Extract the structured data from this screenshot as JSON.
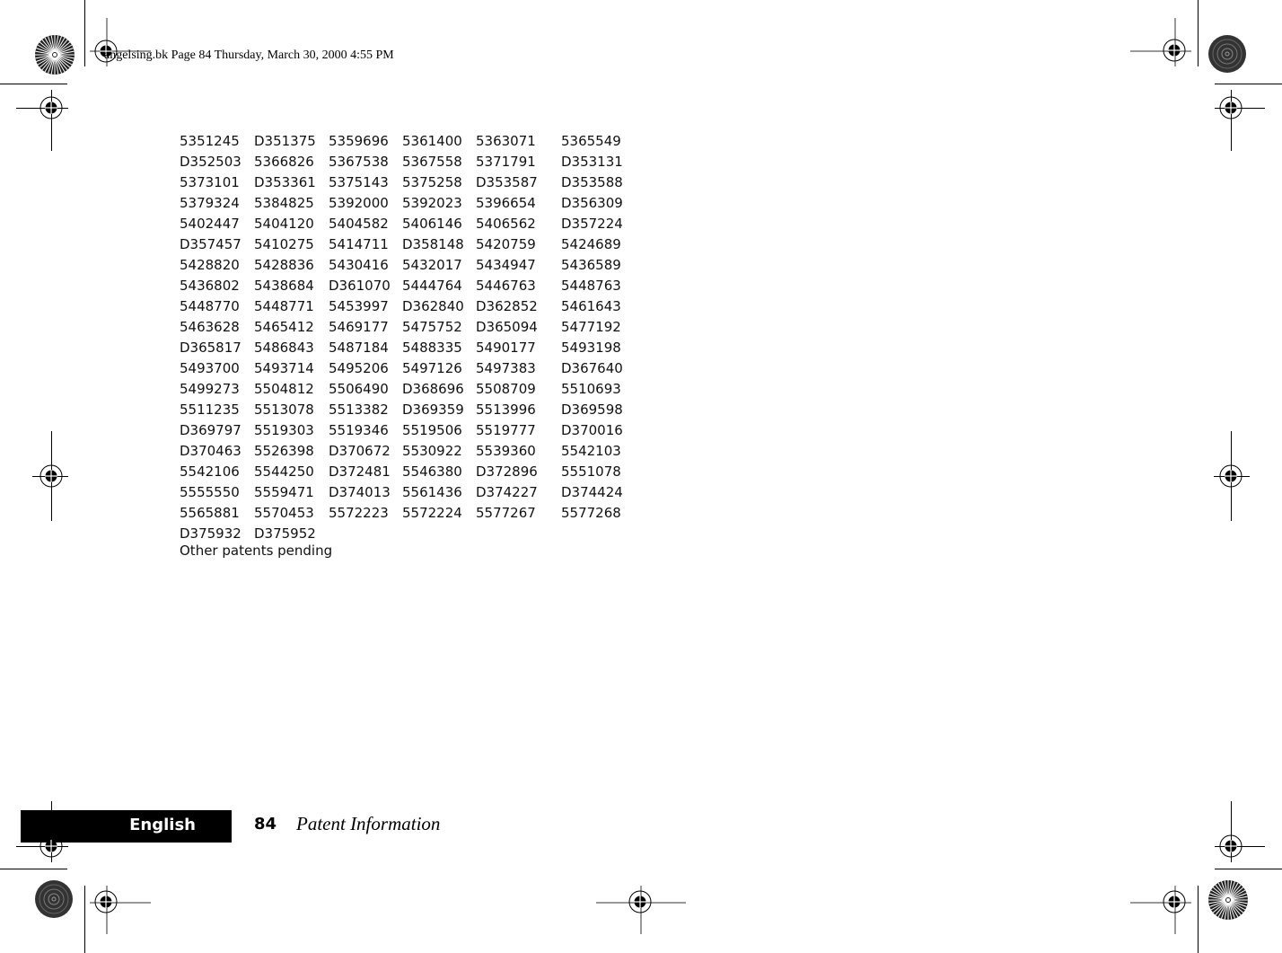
{
  "header": {
    "slug": "angelsing.bk  Page 84  Thursday, March 30, 2000  4:55 PM"
  },
  "patents": {
    "rows": [
      [
        "5351245",
        "D351375",
        "5359696",
        "5361400",
        "5363071",
        "5365549"
      ],
      [
        "D352503",
        "5366826",
        "5367538",
        "5367558",
        "5371791",
        "D353131"
      ],
      [
        "5373101",
        "D353361",
        "5375143",
        "5375258",
        "D353587",
        "D353588"
      ],
      [
        "5379324",
        "5384825",
        "5392000",
        "5392023",
        "5396654",
        "D356309"
      ],
      [
        "5402447",
        "5404120",
        "5404582",
        "5406146",
        "5406562",
        "D357224"
      ],
      [
        "D357457",
        "5410275",
        "5414711",
        "D358148",
        "5420759",
        "5424689"
      ],
      [
        "5428820",
        "5428836",
        "5430416",
        "5432017",
        "5434947",
        "5436589"
      ],
      [
        "5436802",
        "5438684",
        "D361070",
        "5444764",
        "5446763",
        "5448763"
      ],
      [
        "5448770",
        "5448771",
        "5453997",
        "D362840",
        "D362852",
        "5461643"
      ],
      [
        "5463628",
        "5465412",
        "5469177",
        "5475752",
        "D365094",
        "5477192"
      ],
      [
        "D365817",
        "5486843",
        "5487184",
        "5488335",
        "5490177",
        "5493198"
      ],
      [
        "5493700",
        "5493714",
        "5495206",
        "5497126",
        "5497383",
        "D367640"
      ],
      [
        "5499273",
        "5504812",
        "5506490",
        "D368696",
        "5508709",
        "5510693"
      ],
      [
        "5511235",
        "5513078",
        "5513382",
        "D369359",
        "5513996",
        "D369598"
      ],
      [
        "D369797",
        "5519303",
        "5519346",
        "5519506",
        "5519777",
        "D370016"
      ],
      [
        "D370463",
        "5526398",
        "D370672",
        "5530922",
        "5539360",
        "5542103"
      ],
      [
        "5542106",
        "5544250",
        "D372481",
        "5546380",
        "D372896",
        "5551078"
      ],
      [
        "5555550",
        "5559471",
        "D374013",
        "5561436",
        "D374227",
        "D374424"
      ],
      [
        "5565881",
        "5570453",
        "5572223",
        "5572224",
        "5577267",
        "5577268"
      ],
      [
        "D375932",
        "D375952",
        "",
        "",
        "",
        ""
      ]
    ],
    "pending_note": "Other patents pending"
  },
  "footer": {
    "language": "English",
    "page_number": "84",
    "section_title": "Patent Information"
  }
}
